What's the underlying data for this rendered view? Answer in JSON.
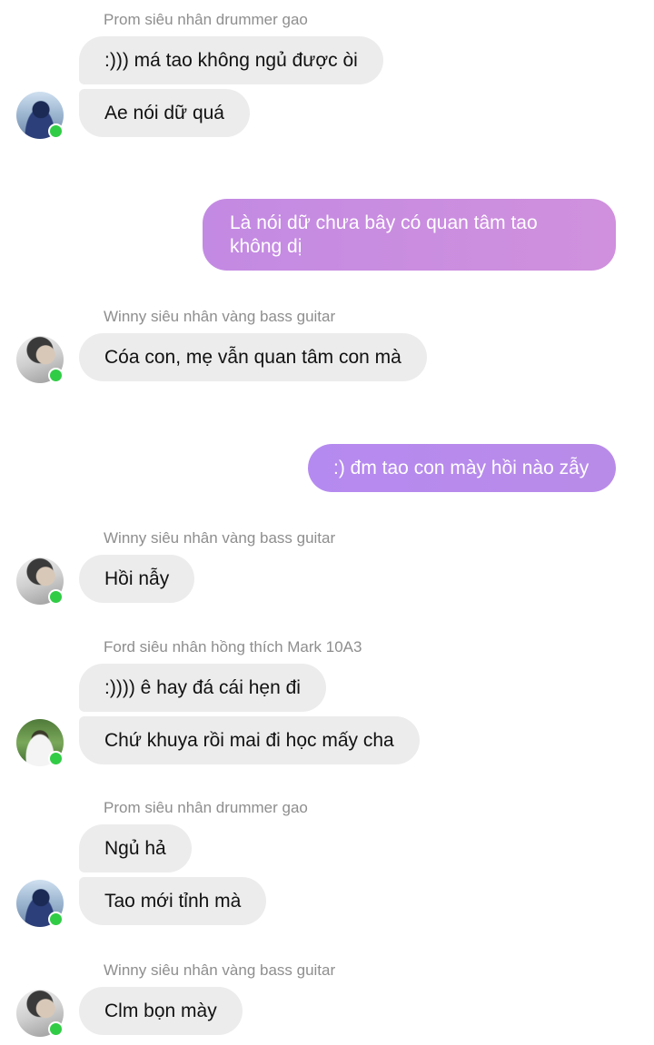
{
  "chat": {
    "groups": [
      {
        "sender": "Prom siêu nhân drummer gao",
        "messages": [
          ":))) má tao không ngủ được òi",
          "Ae nói dữ quá"
        ]
      },
      {
        "mine": "Là nói dữ chưa bây có quan tâm tao không dị"
      },
      {
        "sender": "Winny siêu nhân vàng bass guitar",
        "messages": [
          "Cóa con, mẹ vẫn quan tâm con mà"
        ]
      },
      {
        "mine": ":) đm tao con mày hồi nào zẫy"
      },
      {
        "sender": "Winny siêu nhân vàng bass guitar",
        "messages": [
          "Hồi nẫy"
        ]
      },
      {
        "sender": "Ford siêu nhân hồng thích Mark 10A3",
        "messages": [
          ":)))) ê hay đá cái hẹn đi",
          "Chứ khuya rồi mai đi học mấy cha"
        ]
      },
      {
        "sender": "Prom siêu nhân drummer gao",
        "messages": [
          "Ngủ hả",
          "Tao mới tỉnh mà"
        ]
      },
      {
        "sender": "Winny siêu nhân vàng bass guitar",
        "messages": [
          "Clm bọn mày"
        ]
      }
    ]
  },
  "colors": {
    "incoming_bubble": "#ececec",
    "outgoing_bubble_1": "#c98ee0",
    "outgoing_bubble_2": "#b489ee",
    "online_dot": "#31cc46"
  },
  "icons": {
    "avatar_prom": "avatar-photo",
    "avatar_winny": "avatar-photo",
    "avatar_ford": "avatar-photo",
    "online": "online-status-dot"
  }
}
